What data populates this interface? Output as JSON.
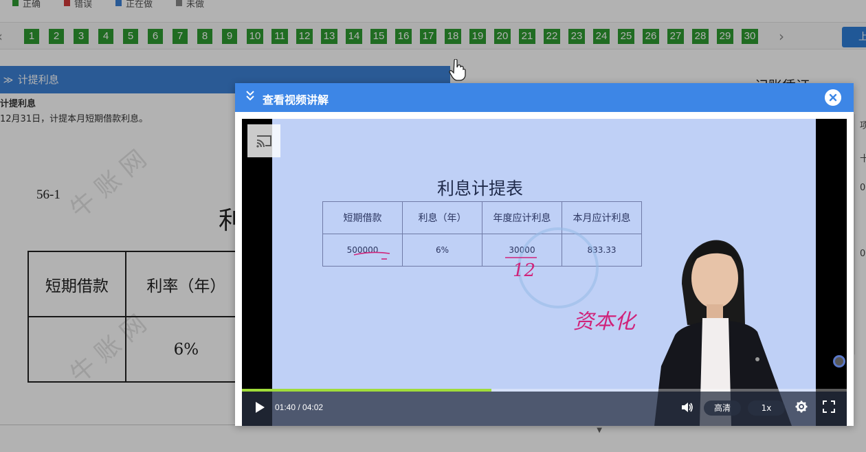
{
  "legend": [
    {
      "label": "正确",
      "color": "#2e9b32"
    },
    {
      "label": "错误",
      "color": "#d23a3a"
    },
    {
      "label": "正在做",
      "color": "#3d82d6"
    },
    {
      "label": "未做",
      "color": "#888888"
    }
  ],
  "question_numbers": [
    "1",
    "2",
    "3",
    "4",
    "5",
    "6",
    "7",
    "8",
    "9",
    "10",
    "11",
    "12",
    "13",
    "14",
    "15",
    "16",
    "17",
    "18",
    "19",
    "20",
    "21",
    "22",
    "23",
    "24",
    "25",
    "26",
    "27",
    "28",
    "29",
    "30"
  ],
  "nav": {
    "prev_arrow": "‹",
    "next_arrow": "›",
    "prev_button": "上"
  },
  "question": {
    "header": "计提利息",
    "title": "计提利息",
    "description": "12月31日，计提本月短期借款利息。"
  },
  "document": {
    "id": "56-1",
    "title_fragment": "利",
    "headers": [
      "短期借款",
      "利率（年）"
    ],
    "values": [
      "",
      "6%"
    ]
  },
  "right_panel": {
    "title": "记账凭证",
    "cells": [
      "项",
      "十",
      "0",
      "0"
    ]
  },
  "modal": {
    "title": "查看视频讲解"
  },
  "video": {
    "slide_title": "利息计提表",
    "table_headers": [
      "短期借款",
      "利息（年）",
      "年度应计利息",
      "本月应计利息"
    ],
    "table_values": [
      "500000",
      "6%",
      "30000",
      "833.33"
    ],
    "handwriting": [
      "12",
      "资本化"
    ],
    "current_time": "01:40",
    "total_time": "04:02",
    "time_display": "01:40 / 04:02",
    "progress_fraction": 0.413,
    "quality": "高清",
    "speed": "1x"
  }
}
